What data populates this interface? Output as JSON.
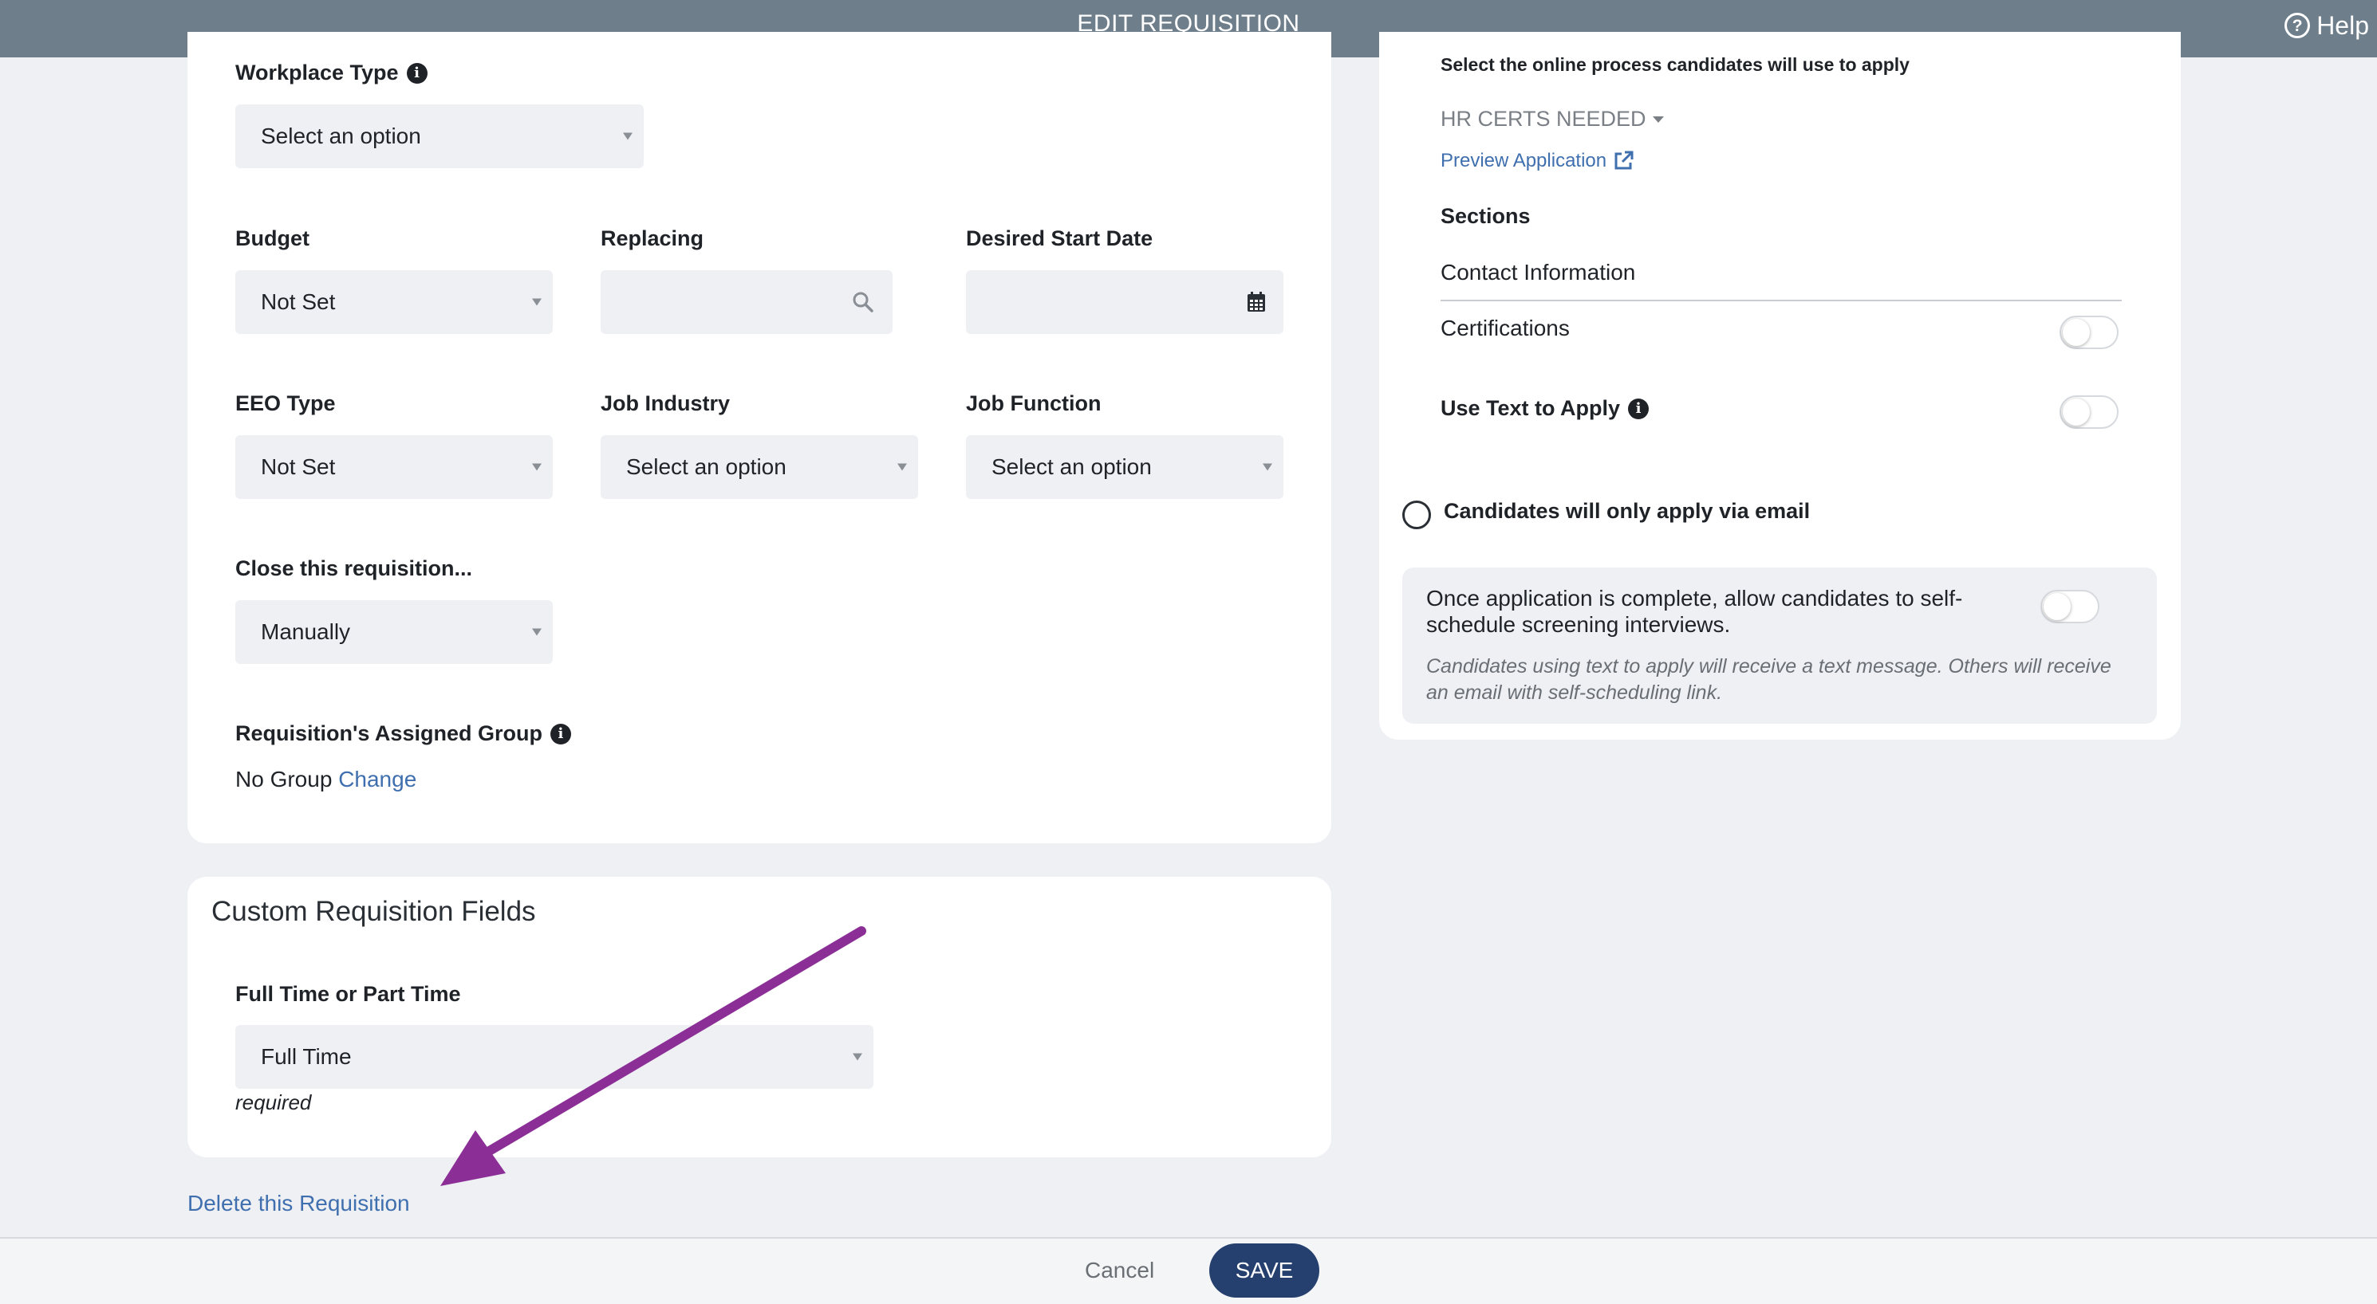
{
  "header": {
    "title": "EDIT REQUISITION",
    "help_label": "Help",
    "help_icon_glyph": "?"
  },
  "main_form": {
    "workplace_type": {
      "label": "Workplace Type",
      "value": "Select an option"
    },
    "budget": {
      "label": "Budget",
      "value": "Not Set"
    },
    "replacing": {
      "label": "Replacing",
      "value": ""
    },
    "desired_start_date": {
      "label": "Desired Start Date",
      "value": ""
    },
    "eeo_type": {
      "label": "EEO Type",
      "value": "Not Set"
    },
    "job_industry": {
      "label": "Job Industry",
      "value": "Select an option"
    },
    "job_function": {
      "label": "Job Function",
      "value": "Select an option"
    },
    "close_requisition": {
      "label": "Close this requisition...",
      "value": "Manually"
    },
    "assigned_group": {
      "label": "Requisition's Assigned Group",
      "value": "No Group",
      "change_link": "Change"
    }
  },
  "custom_fields": {
    "title": "Custom Requisition Fields",
    "full_or_part_time": {
      "label": "Full Time or Part Time",
      "value": "Full Time",
      "note": "required"
    }
  },
  "apply_panel": {
    "instruction": "Select the online process candidates will use to apply",
    "process_selected": "HR CERTS NEEDED",
    "preview_link": "Preview Application",
    "sections_title": "Sections",
    "sections": [
      {
        "label": "Contact Information",
        "has_toggle": false
      },
      {
        "label": "Certifications",
        "has_toggle": true,
        "on": false
      }
    ],
    "text_to_apply": {
      "label": "Use Text to Apply",
      "on": false
    },
    "email_only": {
      "label": "Candidates will only apply via email",
      "selected": false
    },
    "self_schedule": {
      "text": "Once application is complete, allow candidates to self-schedule screening interviews.",
      "note": "Candidates using text to apply will receive a text message. Others will receive an email with self-scheduling link.",
      "on": false
    }
  },
  "footer": {
    "delete_link": "Delete this Requisition",
    "cancel_label": "Cancel",
    "save_label": "SAVE"
  },
  "colors": {
    "topbar": "#6e7f8b",
    "link": "#3f6fae",
    "save_button": "#253f6e",
    "annotation_arrow": "#8b2f97"
  }
}
